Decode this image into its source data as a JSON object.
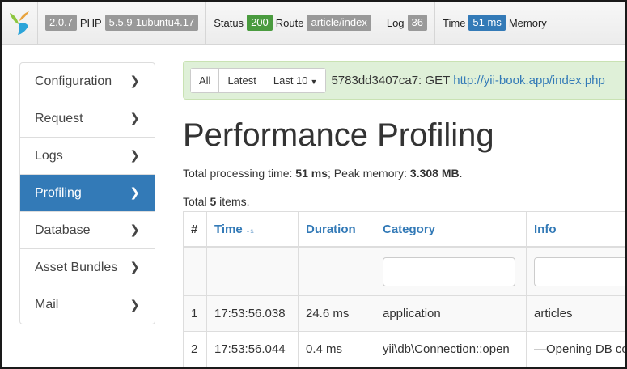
{
  "toolbar": {
    "version": "2.0.7",
    "php_label": "PHP",
    "php_version": "5.5.9-1ubuntu4.17",
    "status_label": "Status",
    "status_code": "200",
    "route_label": "Route",
    "route_value": "article/index",
    "log_label": "Log",
    "log_count": "36",
    "time_label": "Time",
    "time_value": "51 ms",
    "memory_label": "Memory"
  },
  "sidebar": {
    "items": [
      {
        "label": "Configuration",
        "active": false
      },
      {
        "label": "Request",
        "active": false
      },
      {
        "label": "Logs",
        "active": false
      },
      {
        "label": "Profiling",
        "active": true
      },
      {
        "label": "Database",
        "active": false
      },
      {
        "label": "Asset Bundles",
        "active": false
      },
      {
        "label": "Mail",
        "active": false
      }
    ]
  },
  "request_bar": {
    "buttons": [
      "All",
      "Latest",
      "Last 10"
    ],
    "request_text": "5783dd3407ca7: GET",
    "request_url": "http://yii-book.app/index.php"
  },
  "page": {
    "title": "Performance Profiling",
    "summary_prefix": "Total processing time:",
    "processing_time": "51 ms",
    "summary_mid": "; Peak memory:",
    "peak_memory": "3.308 MB",
    "summary_suffix": ".",
    "total_prefix": "Total",
    "total_count": "5",
    "total_suffix": "items."
  },
  "table": {
    "columns": [
      "#",
      "Time",
      "Duration",
      "Category",
      "Info"
    ],
    "rows": [
      {
        "num": "1",
        "time": "17:53:56.038",
        "duration": "24.6 ms",
        "category": "application",
        "info": "articles"
      },
      {
        "num": "2",
        "time": "17:53:56.044",
        "duration": "0.4 ms",
        "category": "yii\\db\\Connection::open",
        "info": "Opening DB connection"
      }
    ]
  },
  "colors": {
    "accent": "#337ab7",
    "success_bg": "#dff0d8",
    "status_ok": "#4a9b3f"
  }
}
